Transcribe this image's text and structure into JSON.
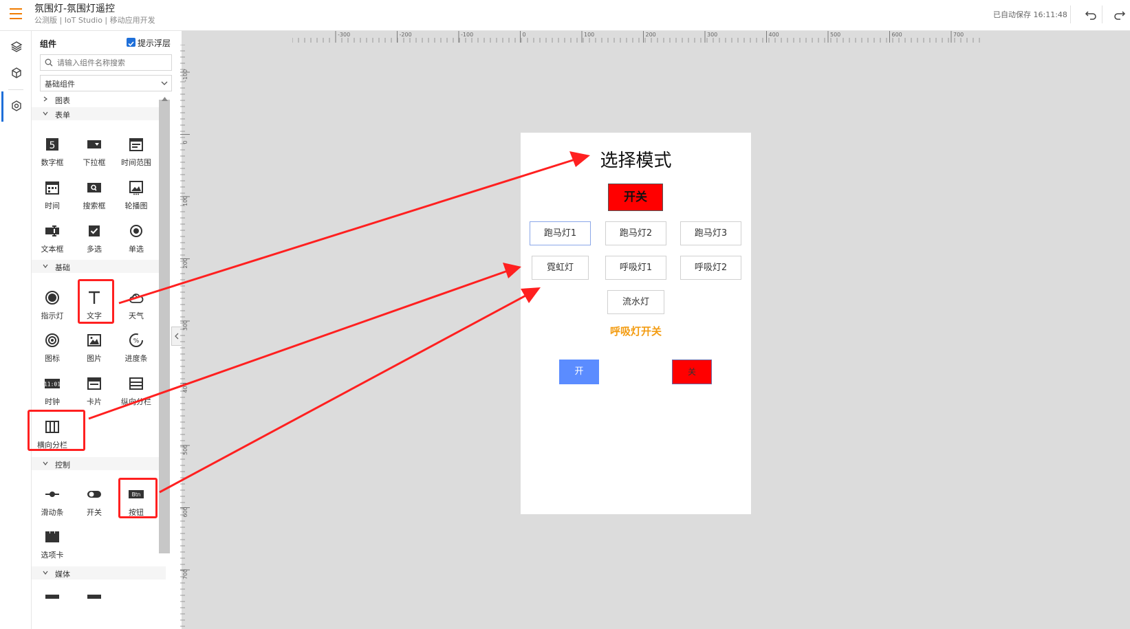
{
  "header": {
    "title": "氛围灯-氛围灯遥控",
    "subtitle": "公测版 | IoT Studio | 移动应用开发",
    "save_status": "已自动保存 16:11:48"
  },
  "panel": {
    "title": "组件",
    "overlay_label": "提示浮层",
    "search_placeholder": "请输入组件名称搜索",
    "category": "基础组件",
    "groups": {
      "chart": "图表",
      "form": "表单",
      "basic": "基础",
      "control": "控制",
      "media": "媒体"
    },
    "form_items": [
      "数字框",
      "下拉框",
      "时间范围",
      "时间",
      "搜索框",
      "轮播图",
      "文本框",
      "多选",
      "单选"
    ],
    "basic_items": [
      "指示灯",
      "文字",
      "天气",
      "图标",
      "图片",
      "进度条",
      "时钟",
      "卡片",
      "纵向分栏",
      "横向分栏"
    ],
    "control_items": [
      "滑动条",
      "开关",
      "按钮",
      "选项卡"
    ]
  },
  "ruler": {
    "h_labels": [
      "-300",
      "-200",
      "-100",
      "0",
      "100",
      "200",
      "300",
      "400",
      "500",
      "600",
      "700"
    ],
    "v_labels": [
      "-100",
      "0",
      "100",
      "200",
      "300",
      "400",
      "500",
      "600",
      "700"
    ]
  },
  "preview": {
    "title": "选择模式",
    "power_button": "开关",
    "modes": [
      "跑马灯1",
      "跑马灯2",
      "跑马灯3",
      "霓虹灯",
      "呼吸灯1",
      "呼吸灯2",
      "流水灯"
    ],
    "breath_title": "呼吸灯开关",
    "on_label": "开",
    "off_label": "关"
  },
  "colors": {
    "accent": "#1e6fd9",
    "brand_orange": "#f07c00",
    "annotation_red": "#ff2020",
    "on_button": "#5b8cff",
    "power_red": "#ff0000",
    "breath_text": "#f39c12"
  }
}
